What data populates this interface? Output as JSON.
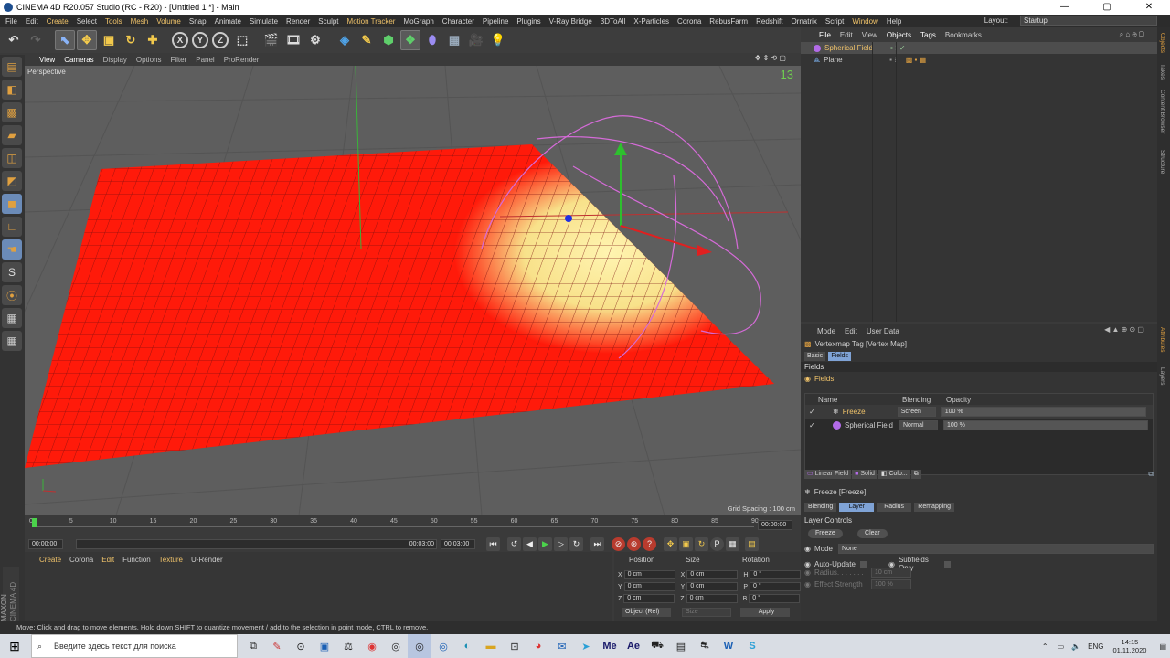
{
  "window": {
    "title": "CINEMA 4D R20.057 Studio (RC - R20) - [Untitled 1 *] - Main",
    "minimize": "—",
    "maximize": "▢",
    "close": "✕"
  },
  "menu": [
    "File",
    "Edit",
    "Create",
    "Select",
    "Tools",
    "Mesh",
    "Volume",
    "Snap",
    "Animate",
    "Simulate",
    "Render",
    "Sculpt",
    "Motion Tracker",
    "MoGraph",
    "Character",
    "Pipeline",
    "Plugins",
    "V-Ray Bridge",
    "3DToAll",
    "X-Particles",
    "Corona",
    "RebusFarm",
    "Redshift",
    "Ornatrix",
    "Script",
    "Window",
    "Help"
  ],
  "layout": {
    "label": "Layout:",
    "value": "Startup"
  },
  "viewport": {
    "menu": [
      "View",
      "Cameras",
      "Display",
      "Options",
      "Filter",
      "Panel",
      "ProRender"
    ],
    "camera_label": "Perspective",
    "grid_spacing": "Grid Spacing : 100 cm",
    "corner_number": "13"
  },
  "timeline": {
    "ticks": [
      "0",
      "5",
      "10",
      "15",
      "20",
      "25",
      "30",
      "35",
      "40",
      "45",
      "50",
      "55",
      "60",
      "65",
      "70",
      "75",
      "80",
      "85",
      "90"
    ],
    "current_frame": "00:00:00",
    "start": "00:00:00",
    "range_end": "00:03:00",
    "end": "00:03:00",
    "playhead_fraction": 0.0
  },
  "material_panel": {
    "menu": [
      "Create",
      "Corona",
      "Edit",
      "Function",
      "Texture",
      "U-Render"
    ],
    "brand_1": "MAXON",
    "brand_2": "CINEMA 4D"
  },
  "coordinates": {
    "headers": [
      "Position",
      "Size",
      "Rotation"
    ],
    "rows": [
      {
        "axis": "X",
        "pos": "0 cm",
        "size_axis": "X",
        "size": "0 cm",
        "rot_axis": "H",
        "rot": "0 °"
      },
      {
        "axis": "Y",
        "pos": "0 cm",
        "size_axis": "Y",
        "size": "0 cm",
        "rot_axis": "P",
        "rot": "0 °"
      },
      {
        "axis": "Z",
        "pos": "0 cm",
        "size_axis": "Z",
        "size": "0 cm",
        "rot_axis": "B",
        "rot": "0 °"
      }
    ],
    "mode": "Object (Rel)",
    "size_mode": "Size",
    "apply": "Apply"
  },
  "object_manager": {
    "menu": [
      "File",
      "Edit",
      "View",
      "Objects",
      "Tags",
      "Bookmarks"
    ],
    "objects": [
      {
        "name": "Spherical Field",
        "color": "#b36be8"
      },
      {
        "name": "Plane",
        "color": "#7cb3f2"
      }
    ]
  },
  "attribute_manager": {
    "menu": [
      "Mode",
      "Edit",
      "User Data"
    ],
    "tag_title": "Vertexmap Tag [Vertex Map]",
    "tabs": [
      "Basic",
      "Fields"
    ],
    "section": "Fields",
    "subsection": "Fields",
    "columns": [
      "Name",
      "Blending",
      "Opacity"
    ],
    "layers": [
      {
        "name": "Freeze",
        "blend": "Screen",
        "opacity": "100 %"
      },
      {
        "name": "Spherical Field",
        "blend": "Normal",
        "opacity": "100 %"
      }
    ],
    "add_buttons": [
      "Linear Field",
      "Solid",
      "Colo..."
    ],
    "freeze_title": "Freeze [Freeze]",
    "freeze_tabs": [
      "Blending",
      "Layer",
      "Radius",
      "Remapping"
    ],
    "layer_controls": "Layer Controls",
    "freeze_btn": "Freeze",
    "clear_btn": "Clear",
    "mode_label": "Mode",
    "mode_value": "None",
    "auto_update": "Auto-Update",
    "subfields": "Subfields Only",
    "radius_label": "Radius. . . . . . .",
    "radius_value": "10 cm",
    "effect_label": "Effect Strength",
    "effect_value": "100 %"
  },
  "right_strip": [
    "Objects",
    "Takes",
    "Content Browser",
    "Structure",
    "Attributes",
    "Layers"
  ],
  "status": "Move: Click and drag to move elements. Hold down SHIFT to quantize movement / add to the selection in point mode, CTRL to remove.",
  "taskbar": {
    "search_placeholder": "Введите здесь текст для поиска",
    "lang": "ENG",
    "time": "14:15",
    "date": "01.11.2020"
  }
}
